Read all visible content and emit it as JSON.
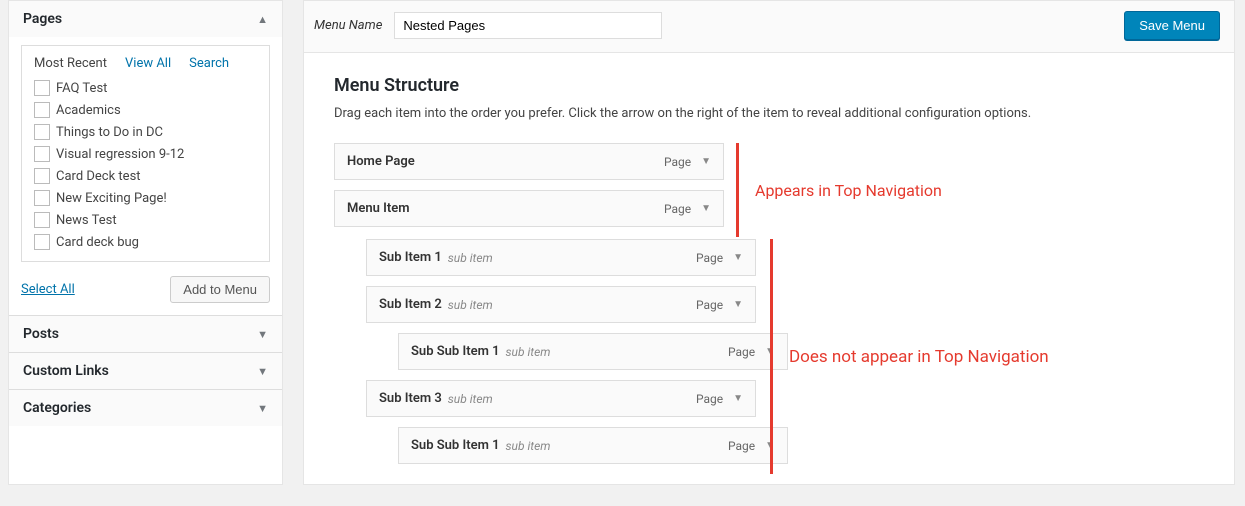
{
  "sidebar": {
    "pages": {
      "title": "Pages",
      "tabs": {
        "recent": "Most Recent",
        "viewall": "View All",
        "search": "Search"
      },
      "items": [
        {
          "label": "FAQ Test"
        },
        {
          "label": "Academics"
        },
        {
          "label": "Things to Do in DC"
        },
        {
          "label": "Visual regression 9-12"
        },
        {
          "label": "Card Deck test"
        },
        {
          "label": "New Exciting Page!"
        },
        {
          "label": "News Test"
        },
        {
          "label": "Card deck bug"
        }
      ],
      "select_all": "Select All",
      "add_to_menu": "Add to Menu"
    },
    "posts": {
      "title": "Posts"
    },
    "custom_links": {
      "title": "Custom Links"
    },
    "categories": {
      "title": "Categories"
    }
  },
  "header": {
    "menu_name_label": "Menu Name",
    "menu_name_value": "Nested Pages",
    "save_menu": "Save Menu"
  },
  "structure": {
    "title": "Menu Structure",
    "description": "Drag each item into the order you prefer. Click the arrow on the right of the item to reveal additional configuration options.",
    "type_label": "Page",
    "items": [
      {
        "title": "Home Page",
        "subtitle": "",
        "indent": 0
      },
      {
        "title": "Menu Item",
        "subtitle": "",
        "indent": 0
      },
      {
        "title": "Sub Item 1",
        "subtitle": "sub item",
        "indent": 1
      },
      {
        "title": "Sub Item 2",
        "subtitle": "sub item",
        "indent": 1
      },
      {
        "title": "Sub Sub Item 1",
        "subtitle": "sub item",
        "indent": 2
      },
      {
        "title": "Sub Item 3",
        "subtitle": "sub item",
        "indent": 1
      },
      {
        "title": "Sub Sub Item 1",
        "subtitle": "sub item",
        "indent": 2
      }
    ]
  },
  "annotations": {
    "appears": "Appears in Top Navigation",
    "not_appears": "Does not appear in Top Navigation"
  }
}
